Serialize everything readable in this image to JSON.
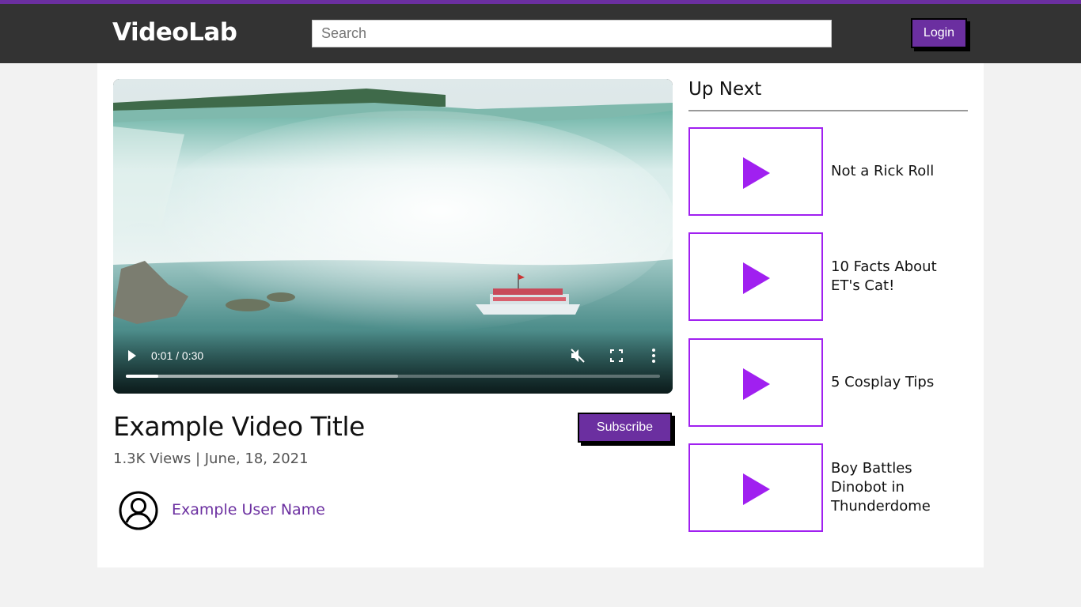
{
  "header": {
    "brand": "VideoLab",
    "search_placeholder": "Search",
    "login_label": "Login"
  },
  "player": {
    "time": "0:01 / 0:30",
    "played_fraction": 0.06,
    "buffered_fraction": 0.51,
    "muted": true
  },
  "video": {
    "title": "Example Video Title",
    "meta": "1.3K Views | June, 18, 2021",
    "subscribe_label": "Subscribe",
    "user_name": "Example User Name"
  },
  "up_next": {
    "heading": "Up Next",
    "items": [
      {
        "title": "Not a Rick Roll"
      },
      {
        "title": "10 Facts About ET's Cat!"
      },
      {
        "title": "5 Cosplay Tips"
      },
      {
        "title": "Boy Battles Dinobot in Thunderdome"
      }
    ]
  },
  "colors": {
    "accent": "#6b2fa0",
    "thumb_accent": "#a020f0",
    "header_bg": "#333333"
  }
}
